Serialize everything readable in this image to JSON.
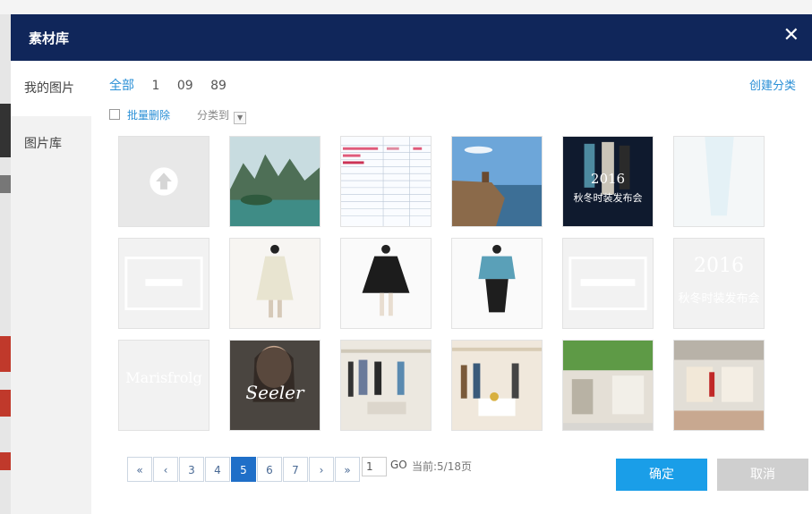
{
  "modal": {
    "title": "素材库"
  },
  "sidebar": {
    "items": [
      {
        "label": "我的图片"
      },
      {
        "label": "图片库"
      }
    ]
  },
  "filters": {
    "items": [
      "全部",
      "1",
      "09",
      "89"
    ],
    "create_label": "创建分类"
  },
  "toolbar": {
    "batch_delete": "批量删除",
    "move_to": "分类到"
  },
  "thumbnails": {
    "poster_title": "2016",
    "poster_subtitle": "秋冬时装发布会",
    "brand": "Marisfrolg",
    "seeler": "Seeler"
  },
  "pagination": {
    "prev_first": "«",
    "prev": "‹",
    "pages": [
      "3",
      "4",
      "5",
      "6",
      "7"
    ],
    "current": "5",
    "next": "›",
    "next_last": "»",
    "input_value": "1",
    "go_label": "GO",
    "current_info": "当前:5/18页"
  },
  "buttons": {
    "ok": "确定",
    "cancel": "取消"
  },
  "colors": {
    "header": "#10265a",
    "accent": "#2a8fd6",
    "ok": "#1a9ee8",
    "cancel": "#cfcfcf"
  }
}
